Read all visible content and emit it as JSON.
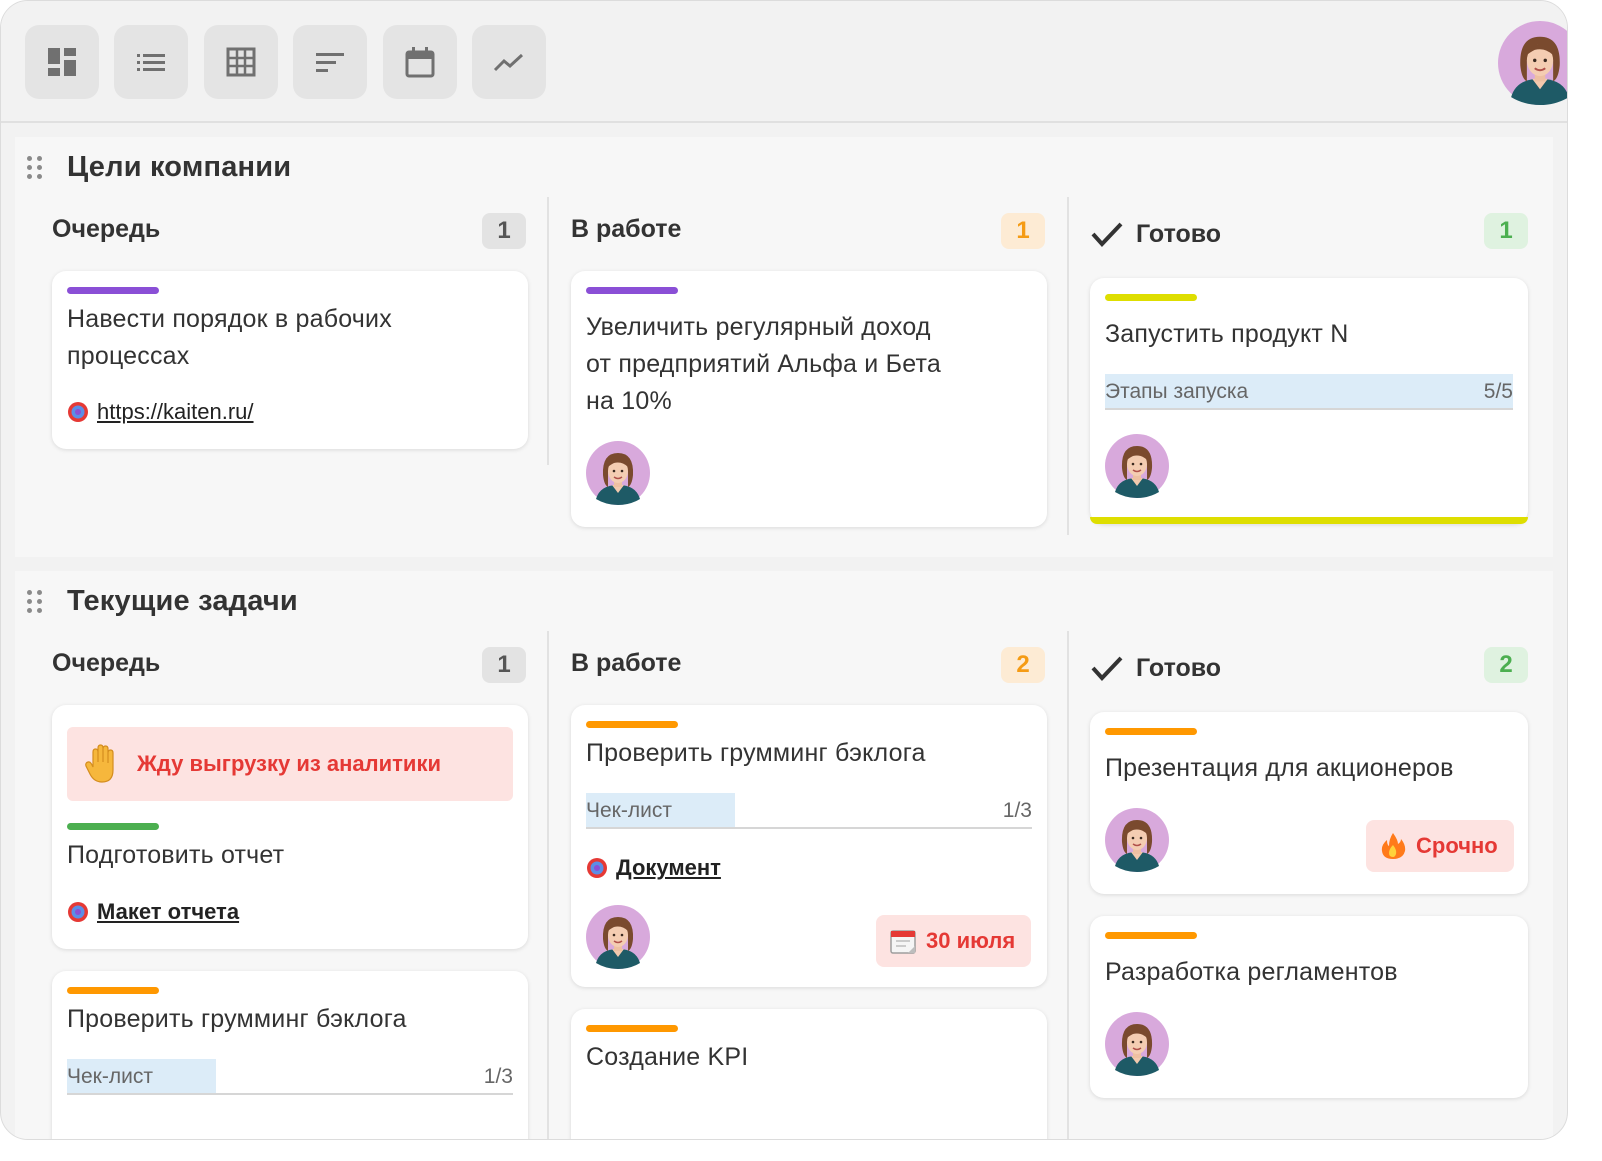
{
  "toolbar": {
    "views": [
      {
        "name": "board-view",
        "icon": "dashboard-icon"
      },
      {
        "name": "list-view",
        "icon": "list-icon"
      },
      {
        "name": "table-view",
        "icon": "table-icon"
      },
      {
        "name": "timeline-view",
        "icon": "timeline-icon"
      },
      {
        "name": "calendar-view",
        "icon": "calendar-icon"
      },
      {
        "name": "reports-view",
        "icon": "chart-icon"
      }
    ]
  },
  "colors": {
    "purple": "#8a4fd6",
    "yellow": "#dede00",
    "green": "#4caf50",
    "orange": "#ff9800",
    "red": "#e53935"
  },
  "sections": [
    {
      "title": "Цели компании",
      "columns": [
        {
          "title": "Очередь",
          "count": "1",
          "cards": [
            {
              "title_lines": [
                "Навести порядок в рабочих",
                "процессах"
              ],
              "link": "https://kaiten.ru/"
            }
          ]
        },
        {
          "title": "В работе",
          "count": "1",
          "cards": [
            {
              "title_lines": [
                "Увеличить регулярный доход",
                "от предприятий Альфа и Бета",
                "на 10%"
              ]
            }
          ]
        },
        {
          "title": "Готово",
          "count": "1",
          "cards": [
            {
              "title": "Запустить продукт N",
              "progress_label": "Этапы запуска",
              "progress_ratio": "5/5",
              "progress_fraction": 1.0
            }
          ]
        }
      ]
    },
    {
      "title": "Текущие задачи",
      "columns": [
        {
          "title": "Очередь",
          "count": "1",
          "cards": [
            {
              "blocker": "Жду выгрузку из аналитики",
              "title": "Подготовить отчет",
              "link": "Макет отчета"
            },
            {
              "title": "Проверить грумминг бэклога",
              "progress_label": "Чек-лист",
              "progress_ratio": "1/3",
              "progress_fraction": 0.333
            }
          ]
        },
        {
          "title": "В работе",
          "count": "2",
          "cards": [
            {
              "title": "Проверить грумминг бэклога",
              "progress_label": "Чек-лист",
              "progress_ratio": "1/3",
              "progress_fraction": 0.333,
              "link": "Документ",
              "due": "30 июля"
            },
            {
              "title": "Создание KPI"
            }
          ]
        },
        {
          "title": "Готово",
          "count": "2",
          "cards": [
            {
              "title": "Презентация для акционеров",
              "tag": "Срочно"
            },
            {
              "title": "Разработка регламентов"
            }
          ]
        }
      ]
    }
  ]
}
